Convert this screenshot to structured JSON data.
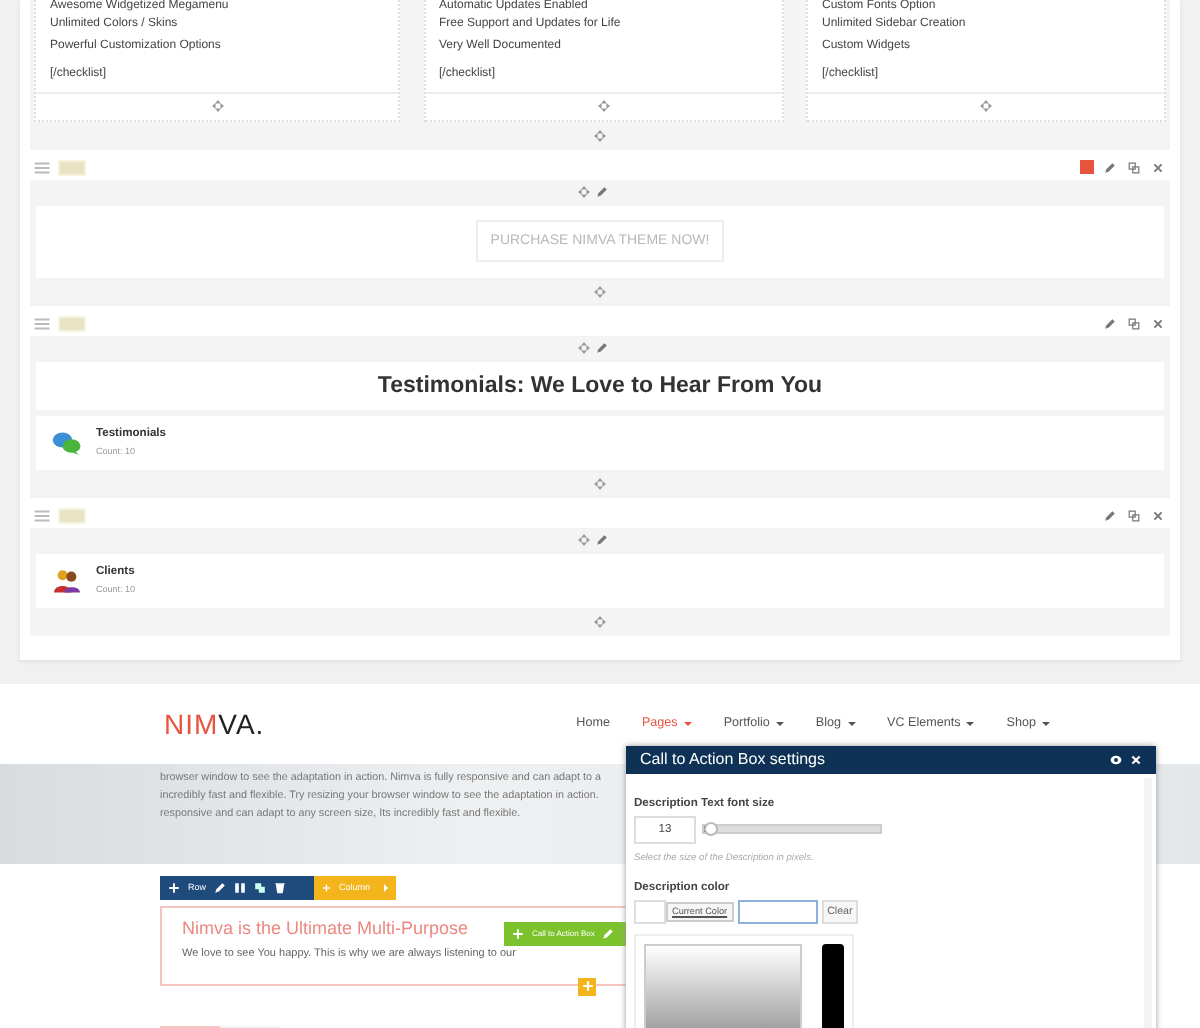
{
  "builder": {
    "columns": [
      {
        "items": [
          "Awesome Widgetized Megamenu",
          "Unlimited Colors / Skins",
          "Powerful Customization Options"
        ],
        "closing": "[/checklist]"
      },
      {
        "items": [
          "Automatic Updates Enabled",
          "Free Support and Updates for Life",
          "Very Well Documented"
        ],
        "closing": "[/checklist]"
      },
      {
        "items": [
          "Custom Fonts Option",
          "Unlimited Sidebar Creation",
          "Custom Widgets"
        ],
        "closing": "[/checklist]"
      }
    ],
    "rows": [
      {
        "kind": "button",
        "color": "#e8553e",
        "button": "PURCHASE NIMVA THEME NOW!"
      },
      {
        "kind": "heading",
        "heading": "Testimonials: We Love to Hear From You",
        "element": {
          "kind": "chat",
          "title": "Testimonials",
          "count": "Count: 10"
        }
      },
      {
        "kind": "element",
        "element": {
          "kind": "people",
          "title": "Clients",
          "count": "Count: 10"
        }
      }
    ]
  },
  "site": {
    "logo_accent": "NIM",
    "logo_rest": "VA.",
    "nav": [
      {
        "label": "Home",
        "selected": false,
        "dropdown": false
      },
      {
        "label": "Pages",
        "selected": true,
        "dropdown": true
      },
      {
        "label": "Portfolio",
        "selected": false,
        "dropdown": true
      },
      {
        "label": "Blog",
        "selected": false,
        "dropdown": true
      },
      {
        "label": "VC Elements",
        "selected": false,
        "dropdown": true
      },
      {
        "label": "Shop",
        "selected": false,
        "dropdown": true
      }
    ],
    "hero_lines": [
      "browser window to see the adaptation in action. Nimva is fully responsive and can adapt to a",
      "incredibly fast and flexible. Try resizing your browser window to see the adaptation in action.",
      "responsive and can adapt to any screen size, Its incredibly fast and flexible."
    ],
    "row_toolbar": "Row",
    "column_toolbar": "Column",
    "element_badge": "Call to Action Box",
    "cta": {
      "title": "Nimva is the Ultimate Multi-Purpose",
      "subtitle": "We love to see You happy. This is why we are always listening to our"
    }
  },
  "dialog": {
    "title": "Call to Action Box settings",
    "font_size": {
      "label": "Description Text font size",
      "value": "13",
      "level": 0.04,
      "hint": "Select the size of the Description in pixels."
    },
    "color": {
      "label": "Description color",
      "current": "Current Color",
      "clear": "Clear"
    }
  }
}
